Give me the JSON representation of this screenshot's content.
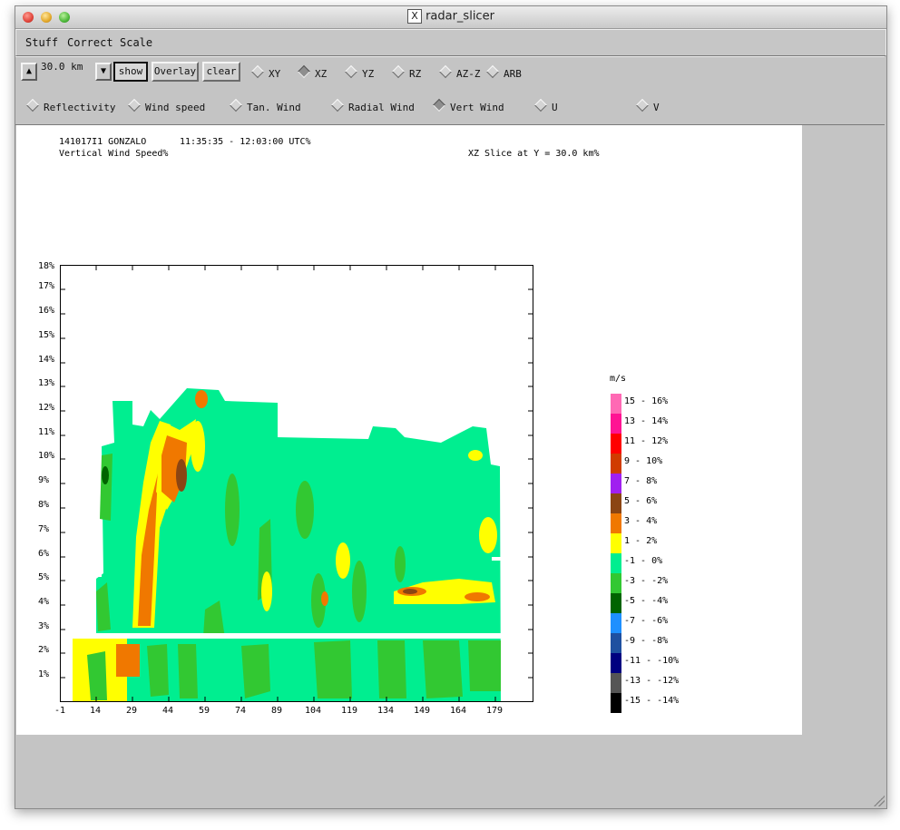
{
  "window": {
    "title": "radar_slicer",
    "x_logo": "X"
  },
  "menu": [
    "Stuff",
    "Correct",
    "Scale"
  ],
  "toolbar": {
    "height_value": "30.0 km",
    "show_label": "show",
    "overlay_label": "Overlay",
    "clear_label": "clear",
    "slice_options": [
      {
        "label": "XY",
        "selected": false
      },
      {
        "label": "XZ",
        "selected": true
      },
      {
        "label": "YZ",
        "selected": false
      },
      {
        "label": "RZ",
        "selected": false
      },
      {
        "label": "AZ-Z",
        "selected": false
      },
      {
        "label": "ARB",
        "selected": false
      }
    ],
    "field_options": [
      {
        "label": "Reflectivity",
        "selected": false
      },
      {
        "label": "Wind speed",
        "selected": false
      },
      {
        "label": "Tan. Wind",
        "selected": false
      },
      {
        "label": "Radial Wind",
        "selected": false
      },
      {
        "label": "Vert Wind",
        "selected": true
      },
      {
        "label": "U",
        "selected": false
      },
      {
        "label": "V",
        "selected": false
      }
    ]
  },
  "plot_header": {
    "line1_left": "141017I1 GONZALO",
    "line1_time": "11:35:35 - 12:03:00 UTC%",
    "line2_left": "Vertical Wind Speed%",
    "line2_right": "XZ Slice at Y = 30.0 km%"
  },
  "axes": {
    "y_labels": [
      "1%",
      "2%",
      "3%",
      "4%",
      "5%",
      "6%",
      "7%",
      "8%",
      "9%",
      "10%",
      "11%",
      "12%",
      "13%",
      "14%",
      "15%",
      "16%",
      "17%",
      "18%"
    ],
    "x_labels": [
      "-1",
      "14",
      "29",
      "44",
      "59",
      "74",
      "89",
      "104",
      "119",
      "134",
      "149",
      "164",
      "179"
    ]
  },
  "colorbar": {
    "unit": "m/s",
    "entries": [
      {
        "label": "15 - 16%",
        "color": "#ff69b4"
      },
      {
        "label": "13 - 14%",
        "color": "#ff1493"
      },
      {
        "label": "11 - 12%",
        "color": "#ff0000"
      },
      {
        "label": "9 - 10%",
        "color": "#d03c00"
      },
      {
        "label": "7 - 8%",
        "color": "#a020f0"
      },
      {
        "label": "5 - 6%",
        "color": "#8b4513"
      },
      {
        "label": "3 - 4%",
        "color": "#f07800"
      },
      {
        "label": "1 - 2%",
        "color": "#ffff00"
      },
      {
        "label": "-1 - 0%",
        "color": "#00ee90"
      },
      {
        "label": "-3 - -2%",
        "color": "#32c832"
      },
      {
        "label": "-5 - -4%",
        "color": "#006400"
      },
      {
        "label": "-7 - -6%",
        "color": "#1e90ff"
      },
      {
        "label": "-9 - -8%",
        "color": "#1e50a0"
      },
      {
        "label": "-11 - -10%",
        "color": "#000080"
      },
      {
        "label": "-13 - -12%",
        "color": "#555555"
      },
      {
        "label": "-15 - -14%",
        "color": "#000000"
      }
    ]
  }
}
